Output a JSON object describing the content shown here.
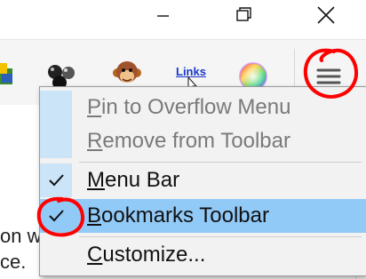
{
  "window_controls": {
    "minimize_icon": "minimize-icon",
    "restore_icon": "restore-icon",
    "close_icon": "close-icon"
  },
  "toolbar": {
    "icons": [
      "extension-icon",
      "balls-icon",
      "monkey-icon",
      "links-icon",
      "color-wheel-icon",
      "hamburger-menu-icon"
    ],
    "links_label": "Links"
  },
  "page": {
    "line1": "on w",
    "line2": "ce."
  },
  "menu": {
    "items": [
      {
        "access_key": "P",
        "rest": "in to Overflow Menu",
        "state": "disabled",
        "checked": false
      },
      {
        "access_key": "R",
        "rest": "emove from Toolbar",
        "state": "disabled",
        "checked": false
      },
      {
        "access_key": "M",
        "rest": "enu Bar",
        "state": "enabled",
        "checked": true
      },
      {
        "access_key": "B",
        "rest": "ookmarks Toolbar",
        "state": "highlighted",
        "checked": true
      },
      {
        "access_key": "C",
        "rest": "ustomize...",
        "state": "enabled",
        "checked": false
      }
    ]
  },
  "colors": {
    "highlight": "#91c9f7",
    "check_gutter": "#cce4f7",
    "annotation": "#ff0000"
  }
}
